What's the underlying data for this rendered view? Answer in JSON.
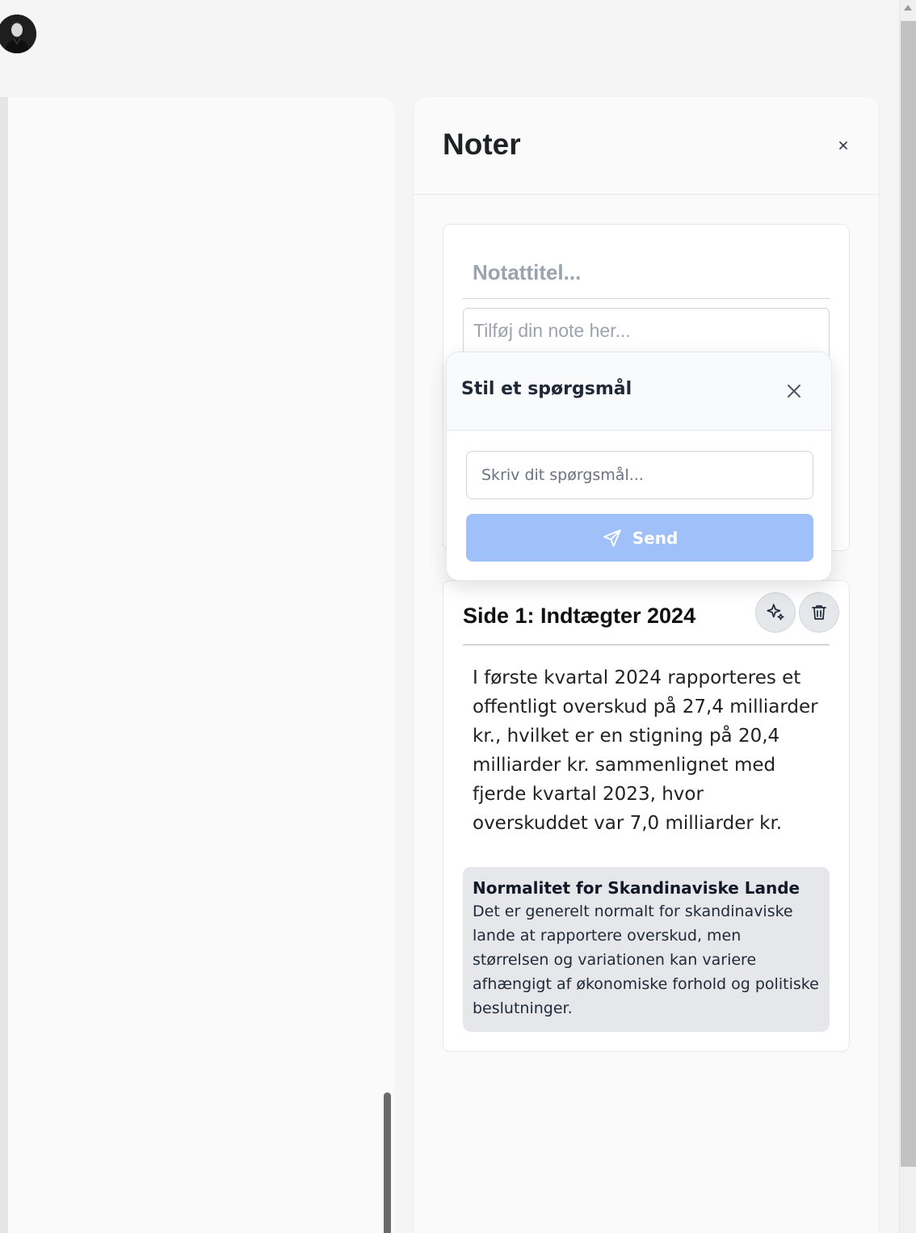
{
  "notes_panel": {
    "title": "Noter",
    "close_label": "×"
  },
  "new_note": {
    "title_placeholder": "Notattitel...",
    "body_placeholder": "Tilføj din note her..."
  },
  "question_popup": {
    "title": "Stil et spørgsmål",
    "input_placeholder": "Skriv dit spørgsmål...",
    "send_label": "Send"
  },
  "saved_note": {
    "title": "Side 1: Indtægter 2024",
    "body": "I første kvartal 2024 rapporteres et offentligt overskud på 27,4 milliarder kr., hvilket er en stigning på 20,4 milliarder kr. sammenlignet med fjerde kvartal 2023, hvor overskuddet var 7,0 milliarder kr.",
    "ai_answer": {
      "title": "Normalitet for Skandinaviske Lande",
      "text": "Det er generelt normalt for skandinaviske lande at rapportere overskud, men størrelsen og variationen kan variere afhængigt af økonomiske forhold og politiske beslutninger."
    }
  },
  "colors": {
    "send_button": "#9fc0f8",
    "panel_bg": "#fafafa",
    "page_bg": "#f5f5f6"
  },
  "icons": [
    "user-avatar",
    "close-icon",
    "send-icon",
    "sparkles-icon",
    "trash-icon"
  ]
}
